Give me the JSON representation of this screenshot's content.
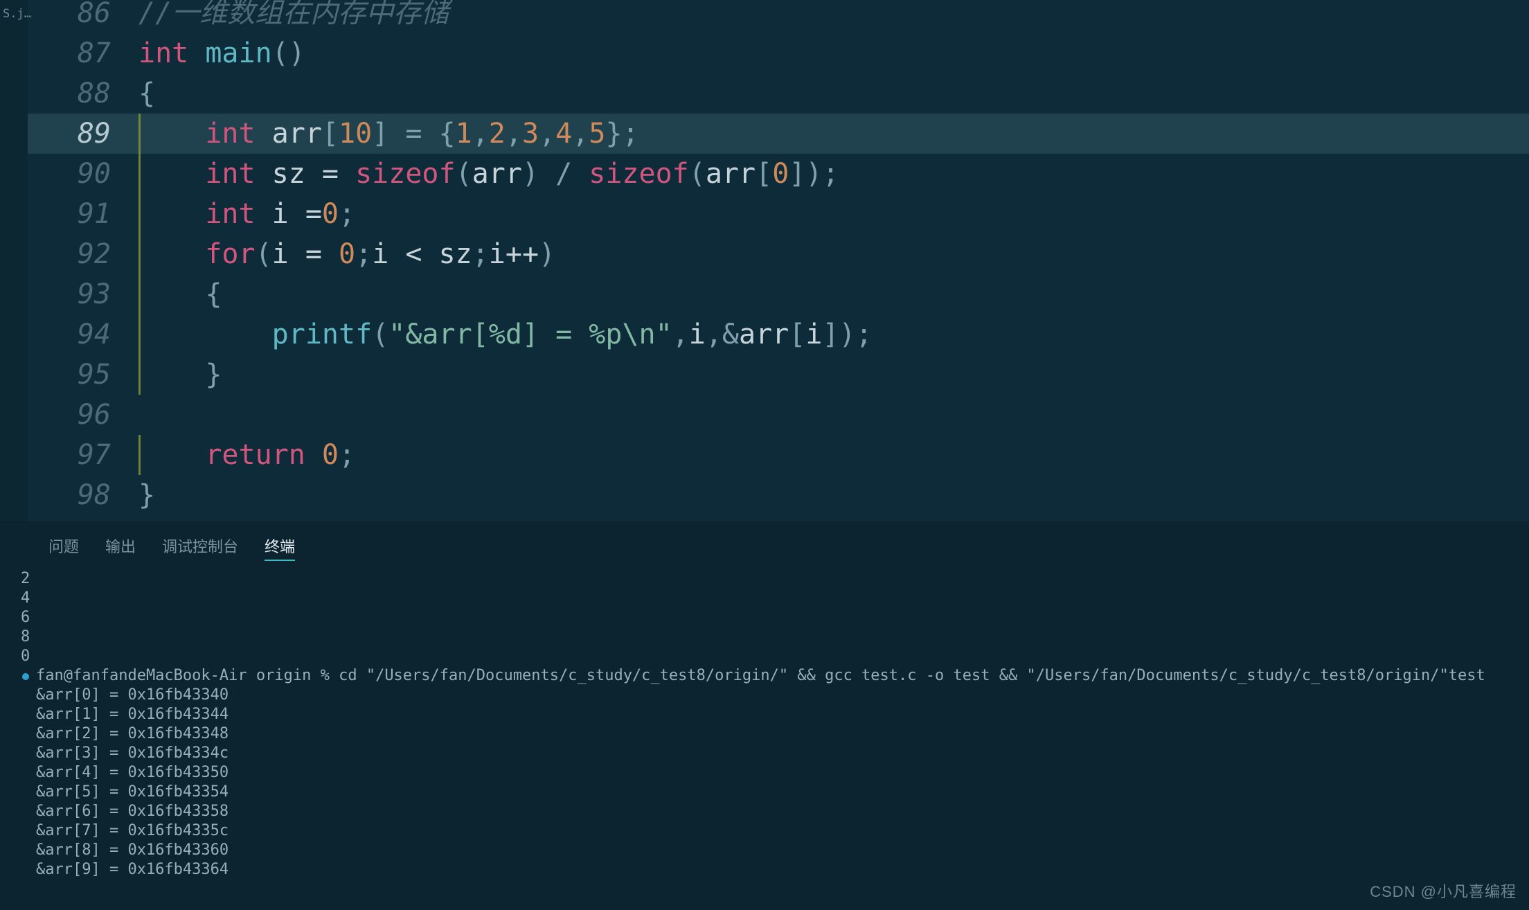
{
  "sidebar": {
    "tab_label": "S.j…"
  },
  "editor": {
    "highlight_line": 89,
    "lines": [
      {
        "num": 86,
        "segments": [
          {
            "cls": "tok-comment",
            "t": "//一维数组在内存中存储"
          }
        ]
      },
      {
        "num": 87,
        "segments": [
          {
            "cls": "tok-type",
            "t": "int"
          },
          {
            "cls": "tok-id",
            "t": " "
          },
          {
            "cls": "tok-fn",
            "t": "main"
          },
          {
            "cls": "tok-pun",
            "t": "()"
          }
        ]
      },
      {
        "num": 88,
        "segments": [
          {
            "cls": "tok-pun",
            "t": "{"
          }
        ]
      },
      {
        "num": 89,
        "indent": 1,
        "segments": [
          {
            "cls": "tok-id",
            "t": "    "
          },
          {
            "cls": "tok-type",
            "t": "int"
          },
          {
            "cls": "tok-id",
            "t": " arr"
          },
          {
            "cls": "tok-pun",
            "t": "["
          },
          {
            "cls": "tok-num",
            "t": "10"
          },
          {
            "cls": "tok-pun",
            "t": "] = {"
          },
          {
            "cls": "tok-num",
            "t": "1"
          },
          {
            "cls": "tok-pun",
            "t": ","
          },
          {
            "cls": "tok-num",
            "t": "2"
          },
          {
            "cls": "tok-pun",
            "t": ","
          },
          {
            "cls": "tok-num",
            "t": "3"
          },
          {
            "cls": "tok-pun",
            "t": ","
          },
          {
            "cls": "tok-num",
            "t": "4"
          },
          {
            "cls": "tok-pun",
            "t": ","
          },
          {
            "cls": "tok-num",
            "t": "5"
          },
          {
            "cls": "tok-pun",
            "t": "};"
          }
        ]
      },
      {
        "num": 90,
        "indent": 1,
        "segments": [
          {
            "cls": "tok-id",
            "t": "    "
          },
          {
            "cls": "tok-type",
            "t": "int"
          },
          {
            "cls": "tok-id",
            "t": " sz = "
          },
          {
            "cls": "tok-kw",
            "t": "sizeof"
          },
          {
            "cls": "tok-pun",
            "t": "("
          },
          {
            "cls": "tok-id",
            "t": "arr"
          },
          {
            "cls": "tok-pun",
            "t": ") / "
          },
          {
            "cls": "tok-kw",
            "t": "sizeof"
          },
          {
            "cls": "tok-pun",
            "t": "("
          },
          {
            "cls": "tok-id",
            "t": "arr"
          },
          {
            "cls": "tok-pun",
            "t": "["
          },
          {
            "cls": "tok-num",
            "t": "0"
          },
          {
            "cls": "tok-pun",
            "t": "]);"
          }
        ]
      },
      {
        "num": 91,
        "indent": 1,
        "segments": [
          {
            "cls": "tok-id",
            "t": "    "
          },
          {
            "cls": "tok-type",
            "t": "int"
          },
          {
            "cls": "tok-id",
            "t": " i ="
          },
          {
            "cls": "tok-num",
            "t": "0"
          },
          {
            "cls": "tok-pun",
            "t": ";"
          }
        ]
      },
      {
        "num": 92,
        "indent": 1,
        "segments": [
          {
            "cls": "tok-id",
            "t": "    "
          },
          {
            "cls": "tok-kw",
            "t": "for"
          },
          {
            "cls": "tok-pun",
            "t": "("
          },
          {
            "cls": "tok-id",
            "t": "i = "
          },
          {
            "cls": "tok-num",
            "t": "0"
          },
          {
            "cls": "tok-pun",
            "t": ";"
          },
          {
            "cls": "tok-id",
            "t": "i < sz"
          },
          {
            "cls": "tok-pun",
            "t": ";"
          },
          {
            "cls": "tok-id",
            "t": "i++"
          },
          {
            "cls": "tok-pun",
            "t": ")"
          }
        ]
      },
      {
        "num": 93,
        "indent": 1,
        "segments": [
          {
            "cls": "tok-id",
            "t": "    "
          },
          {
            "cls": "tok-pun",
            "t": "{"
          }
        ]
      },
      {
        "num": 94,
        "indent": 1,
        "segments": [
          {
            "cls": "tok-id",
            "t": "        "
          },
          {
            "cls": "tok-fn2",
            "t": "printf"
          },
          {
            "cls": "tok-pun",
            "t": "("
          },
          {
            "cls": "tok-str",
            "t": "\"&arr[%d] = %p\\n\""
          },
          {
            "cls": "tok-pun",
            "t": ","
          },
          {
            "cls": "tok-id",
            "t": "i"
          },
          {
            "cls": "tok-pun",
            "t": ",&"
          },
          {
            "cls": "tok-id",
            "t": "arr"
          },
          {
            "cls": "tok-pun",
            "t": "["
          },
          {
            "cls": "tok-id",
            "t": "i"
          },
          {
            "cls": "tok-pun",
            "t": "]);"
          }
        ]
      },
      {
        "num": 95,
        "indent": 1,
        "segments": [
          {
            "cls": "tok-id",
            "t": "    "
          },
          {
            "cls": "tok-pun",
            "t": "}"
          }
        ]
      },
      {
        "num": 96,
        "indent": 1,
        "segments": [
          {
            "cls": "tok-id",
            "t": ""
          }
        ]
      },
      {
        "num": 97,
        "indent": 1,
        "segments": [
          {
            "cls": "tok-id",
            "t": "    "
          },
          {
            "cls": "tok-kw",
            "t": "return"
          },
          {
            "cls": "tok-id",
            "t": " "
          },
          {
            "cls": "tok-num",
            "t": "0"
          },
          {
            "cls": "tok-pun",
            "t": ";"
          }
        ]
      },
      {
        "num": 98,
        "segments": [
          {
            "cls": "tok-pun",
            "t": "}"
          }
        ]
      }
    ]
  },
  "panel": {
    "tabs": [
      {
        "label": "问题",
        "active": false
      },
      {
        "label": "输出",
        "active": false
      },
      {
        "label": "调试控制台",
        "active": false
      },
      {
        "label": "终端",
        "active": true
      }
    ],
    "pre_output": [
      "2",
      "4",
      "6",
      "8",
      "0"
    ],
    "prompt": "fan@fanfandeMacBook-Air origin % cd \"/Users/fan/Documents/c_study/c_test8/origin/\" && gcc test.c -o test && \"/Users/fan/Documents/c_study/c_test8/origin/\"test",
    "run_output": [
      "&arr[0] = 0x16fb43340",
      "&arr[1] = 0x16fb43344",
      "&arr[2] = 0x16fb43348",
      "&arr[3] = 0x16fb4334c",
      "&arr[4] = 0x16fb43350",
      "&arr[5] = 0x16fb43354",
      "&arr[6] = 0x16fb43358",
      "&arr[7] = 0x16fb4335c",
      "&arr[8] = 0x16fb43360",
      "&arr[9] = 0x16fb43364"
    ]
  },
  "watermark": "CSDN @小凡喜编程"
}
